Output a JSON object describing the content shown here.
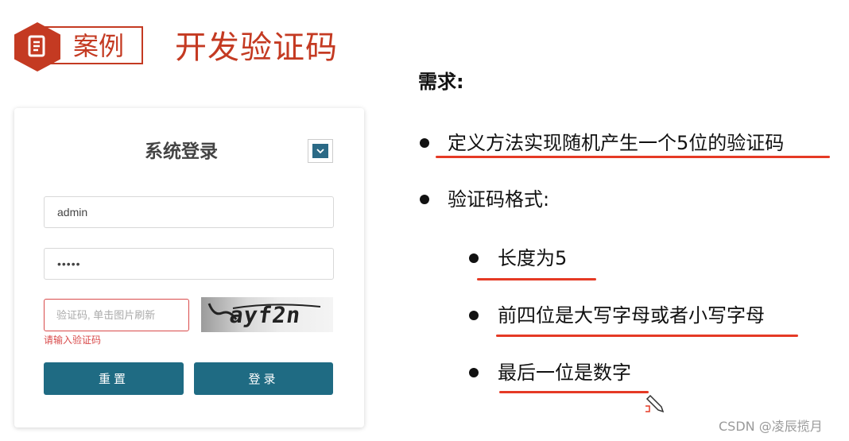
{
  "header": {
    "badge_label": "案例",
    "title": "开发验证码",
    "badge_color": "#c43a22"
  },
  "login_card": {
    "title": "系统登录",
    "username_value": "admin",
    "password_value": "•••••",
    "captcha_placeholder": "验证码, 单击图片刷新",
    "captcha_image_text": "ayf2n",
    "captcha_error": "请输入验证码",
    "reset_label": "重置",
    "login_label": "登录",
    "button_color": "#1f6b83"
  },
  "requirements": {
    "heading": "需求:",
    "items": [
      {
        "text": "定义方法实现随机产生一个5位的验证码"
      },
      {
        "text": "验证码格式:"
      }
    ],
    "sub_items": [
      {
        "text": "长度为5"
      },
      {
        "text": "前四位是大写字母或者小写字母"
      },
      {
        "text": "最后一位是数字"
      }
    ],
    "underline_color": "#e53a25"
  },
  "watermark": "CSDN @凌辰揽月"
}
